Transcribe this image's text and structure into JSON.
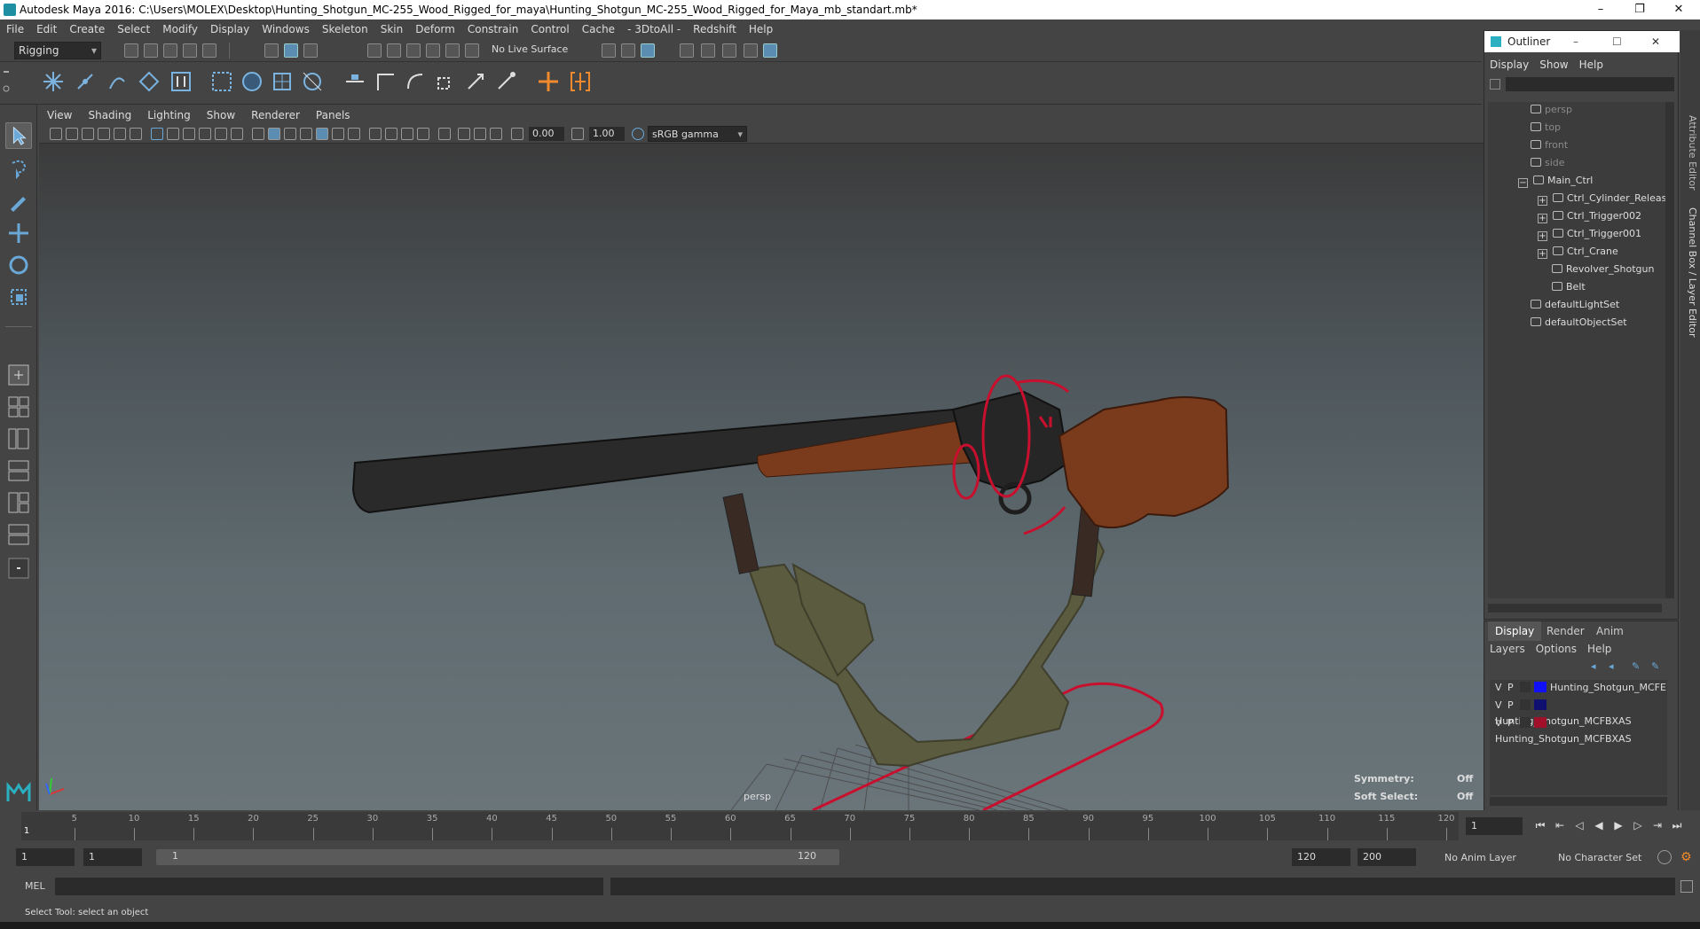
{
  "window": {
    "title": "Autodesk Maya 2016: C:\\Users\\MOLEX\\Desktop\\Hunting_Shotgun_MC-255_Wood_Rigged_for_maya\\Hunting_Shotgun_MC-255_Wood_Rigged_for_Maya_mb_standart.mb*",
    "minimize": "–",
    "maximize": "❐",
    "close": "✕"
  },
  "menubar": [
    "File",
    "Edit",
    "Create",
    "Select",
    "Modify",
    "Display",
    "Windows",
    "Skeleton",
    "Skin",
    "Deform",
    "Constrain",
    "Control",
    "Cache",
    "- 3DtoAll -",
    "Redshift",
    "Help"
  ],
  "statusline": {
    "mode": "Rigging",
    "live_surface": "No Live Surface"
  },
  "panel_menu": [
    "View",
    "Shading",
    "Lighting",
    "Show",
    "Renderer",
    "Panels"
  ],
  "panel_bar": {
    "exposure": "0.00",
    "gamma": "1.00",
    "color_space": "sRGB gamma"
  },
  "viewport": {
    "camera_label": "persp",
    "hud": {
      "symmetry_label": "Symmetry:",
      "symmetry_value": "Off",
      "soft_select_label": "Soft Select:",
      "soft_select_value": "Off"
    },
    "colors": {
      "barrel": "#2a2a2a",
      "stock": "#7a3a1c",
      "strap": "#5b5b3f",
      "control": "#c8102e"
    }
  },
  "outliner": {
    "title": "Outliner",
    "menu": [
      "Display",
      "Show",
      "Help"
    ],
    "items": [
      {
        "label": "persp",
        "indent": 0,
        "dim": true,
        "expander": ""
      },
      {
        "label": "top",
        "indent": 0,
        "dim": true,
        "expander": ""
      },
      {
        "label": "front",
        "indent": 0,
        "dim": true,
        "expander": ""
      },
      {
        "label": "side",
        "indent": 0,
        "dim": true,
        "expander": ""
      },
      {
        "label": "Main_Ctrl",
        "indent": 0,
        "dim": false,
        "expander": "−"
      },
      {
        "label": "Ctrl_Cylinder_Release",
        "indent": 1,
        "dim": false,
        "expander": "+"
      },
      {
        "label": "Ctrl_Trigger002",
        "indent": 1,
        "dim": false,
        "expander": "+"
      },
      {
        "label": "Ctrl_Trigger001",
        "indent": 1,
        "dim": false,
        "expander": "+"
      },
      {
        "label": "Ctrl_Crane",
        "indent": 1,
        "dim": false,
        "expander": "+"
      },
      {
        "label": "Revolver_Shotgun",
        "indent": 1,
        "dim": false,
        "expander": ""
      },
      {
        "label": "Belt",
        "indent": 1,
        "dim": false,
        "expander": ""
      },
      {
        "label": "defaultLightSet",
        "indent": 0,
        "dim": false,
        "expander": ""
      },
      {
        "label": "defaultObjectSet",
        "indent": 0,
        "dim": false,
        "expander": ""
      }
    ]
  },
  "layer_editor": {
    "tabs": [
      "Display",
      "Render",
      "Anim"
    ],
    "menu": [
      "Layers",
      "Options",
      "Help"
    ],
    "layers": [
      {
        "v": "V",
        "p": "P",
        "color": "#1010ff",
        "name": "Hunting_Shotgun_MCFE"
      },
      {
        "v": "V",
        "p": "P",
        "color": "#101070",
        "name": "Hunting_Shotgun_MCFBXAS"
      },
      {
        "v": "V",
        "p": "P",
        "color": "#a0102a",
        "name": "Hunting_Shotgun_MCFBXAS"
      }
    ]
  },
  "side_tabs": [
    "Attribute Editor",
    "Channel Box / Layer Editor"
  ],
  "timeline": {
    "ticks": [
      "5",
      "10",
      "15",
      "20",
      "25",
      "30",
      "35",
      "40",
      "45",
      "50",
      "55",
      "60",
      "65",
      "70",
      "75",
      "80",
      "85",
      "90",
      "95",
      "100",
      "105",
      "110",
      "115",
      "120"
    ],
    "current_frame": "1",
    "frame_label": "1"
  },
  "range": {
    "start": "1",
    "anim_start": "1",
    "slider_start": "1",
    "slider_end": "120",
    "anim_end": "120",
    "end": "200",
    "anim_layer": "No Anim Layer",
    "char_set": "No Character Set"
  },
  "cmdline": {
    "label": "MEL"
  },
  "helpline": {
    "text": "Select Tool: select an object"
  }
}
